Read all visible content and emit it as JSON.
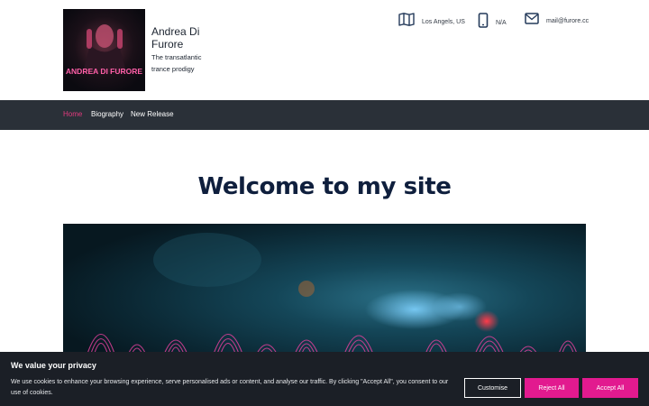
{
  "header": {
    "logo_text": "ANDREA DI FURORE",
    "site_name": "Andrea Di Furore",
    "tagline": "The transatlantic trance prodigy"
  },
  "contact": {
    "location": {
      "icon": "map-icon",
      "label": "Los Angels, US"
    },
    "phone": {
      "icon": "phone-icon",
      "label": "N/A"
    },
    "email": {
      "icon": "mail-icon",
      "label": "mail@furore.cc"
    }
  },
  "nav": {
    "items": [
      {
        "label": "Home",
        "active": true
      },
      {
        "label": "Biography",
        "active": false
      },
      {
        "label": "New Release",
        "active": false
      }
    ]
  },
  "main": {
    "title": "Welcome to my site"
  },
  "cookie_banner": {
    "title": "We value your privacy",
    "text": "We use cookies to enhance your browsing experience, serve personalised ads or content, and analyse our traffic. By clicking \"Accept All\", you consent to our use of cookies.",
    "customise_label": "Customise",
    "reject_label": "Reject All",
    "accept_label": "Accept All"
  },
  "colors": {
    "accent": "#e21a8f",
    "nav_active": "#e33a7e",
    "nav_bg": "#2a3038",
    "title": "#0f1f3d",
    "banner_bg": "#1b1f26"
  }
}
